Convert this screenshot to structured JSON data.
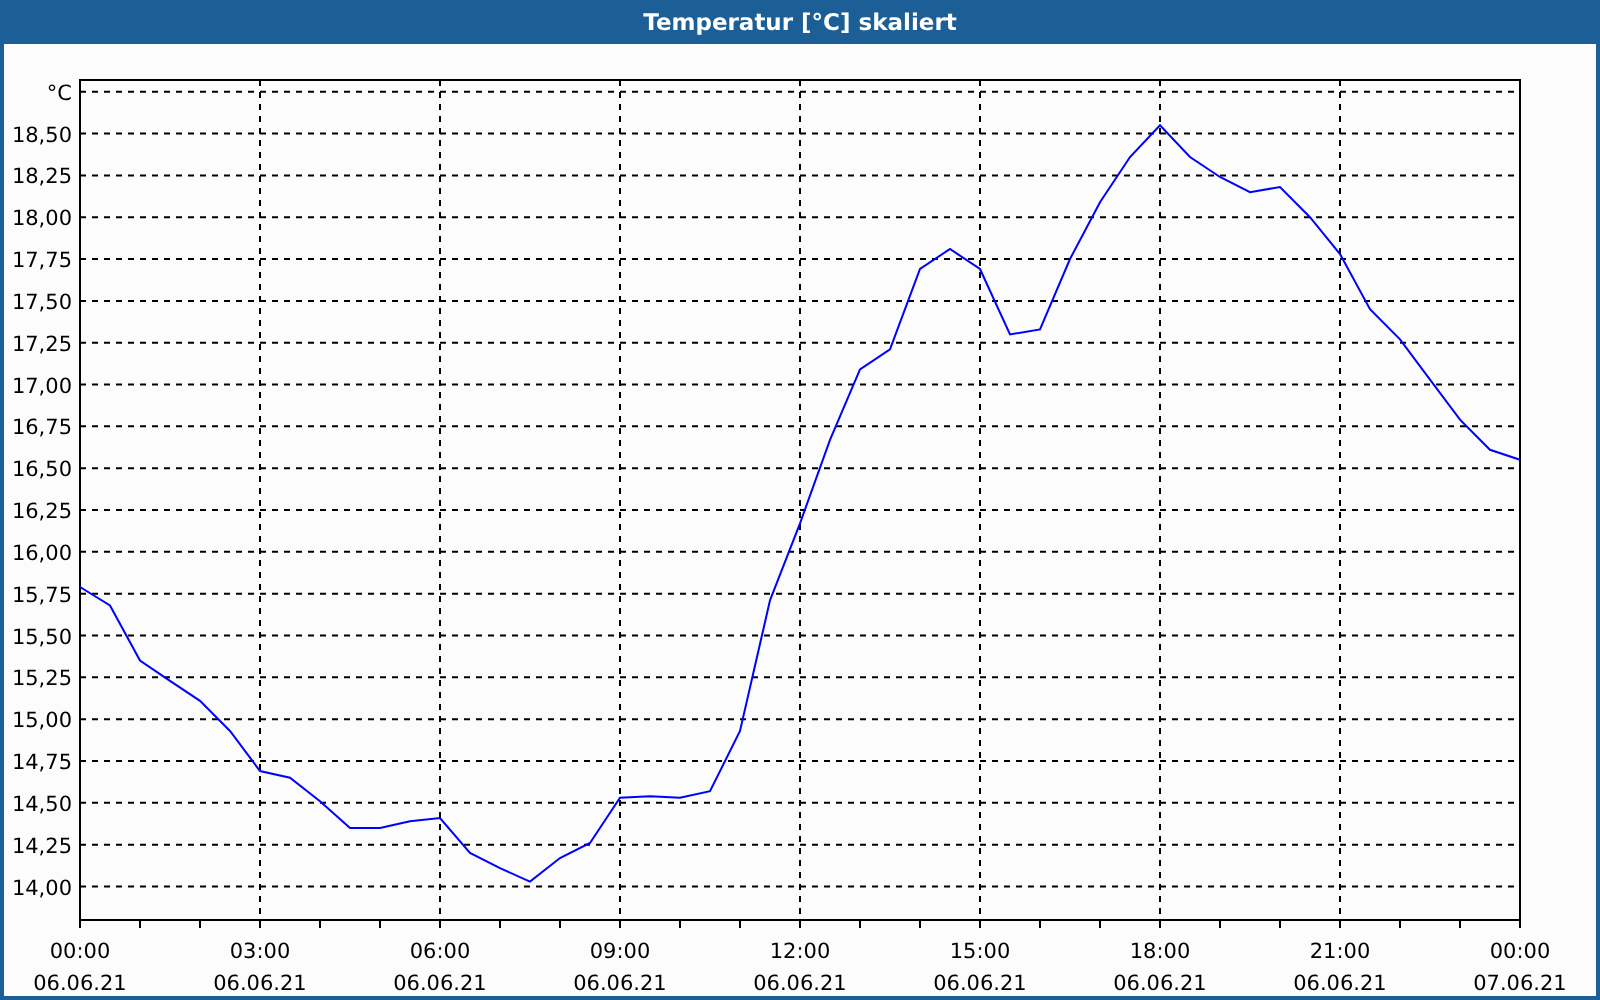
{
  "window": {
    "title": "Temperatur [°C] skaliert"
  },
  "chart": {
    "chart_data": {
      "type": "line",
      "categories": [
        "00:00 06.06.21",
        null,
        null,
        null,
        null,
        null,
        "03:00 06.06.21",
        null,
        null,
        null,
        null,
        null,
        "06:00 06.06.21",
        null,
        null,
        null,
        null,
        null,
        "09:00 06.06.21",
        null,
        null,
        null,
        null,
        null,
        "12:00 06.06.21",
        null,
        null,
        null,
        null,
        null,
        "15:00 06.06.21",
        null,
        null,
        null,
        null,
        null,
        "18:00 06.06.21",
        null,
        null,
        null,
        null,
        null,
        "21:00 06.06.21",
        null,
        null,
        null,
        null,
        null,
        "00:00 07.06.21"
      ],
      "series": [
        {
          "color": "#0000ff",
          "values": [
            15.79,
            15.68,
            15.35,
            15.23,
            15.11,
            14.93,
            14.69,
            14.65,
            14.51,
            14.35,
            14.35,
            14.39,
            14.41,
            14.2,
            14.11,
            14.03,
            14.17,
            14.26,
            14.53,
            14.54,
            14.53,
            14.57,
            14.93,
            15.71,
            16.17,
            16.67,
            17.09,
            17.21,
            17.69,
            17.81,
            17.69,
            17.3,
            17.33,
            17.75,
            18.09,
            18.36,
            18.55,
            18.36,
            18.24,
            18.15,
            18.18,
            18.0,
            17.78,
            17.45,
            17.27,
            17.03,
            16.79,
            16.61,
            16.55
          ]
        }
      ],
      "grid": true,
      "ylim": [
        13.8,
        18.82
      ],
      "yticks": [
        {
          "value": 14,
          "label": "14,00"
        },
        {
          "value": 14.25,
          "label": "14,25"
        },
        {
          "value": 14.5,
          "label": "14,50"
        },
        {
          "value": 14.75,
          "label": "14,75"
        },
        {
          "value": 15,
          "label": "15,00"
        },
        {
          "value": 15.25,
          "label": "15,25"
        },
        {
          "value": 15.5,
          "label": "15,50"
        },
        {
          "value": 15.75,
          "label": "15,75"
        },
        {
          "value": 16,
          "label": "16,00"
        },
        {
          "value": 16.25,
          "label": "16,25"
        },
        {
          "value": 16.5,
          "label": "16,50"
        },
        {
          "value": 16.75,
          "label": "16,75"
        },
        {
          "value": 17,
          "label": "17,00"
        },
        {
          "value": 17.25,
          "label": "17,25"
        },
        {
          "value": 17.5,
          "label": "17,50"
        },
        {
          "value": 17.75,
          "label": "17,75"
        },
        {
          "value": 18,
          "label": "18,00"
        },
        {
          "value": 18.25,
          "label": "18,25"
        },
        {
          "value": 18.5,
          "label": "18,50"
        },
        {
          "value": 18.75,
          "label": "°C"
        }
      ]
    }
  }
}
